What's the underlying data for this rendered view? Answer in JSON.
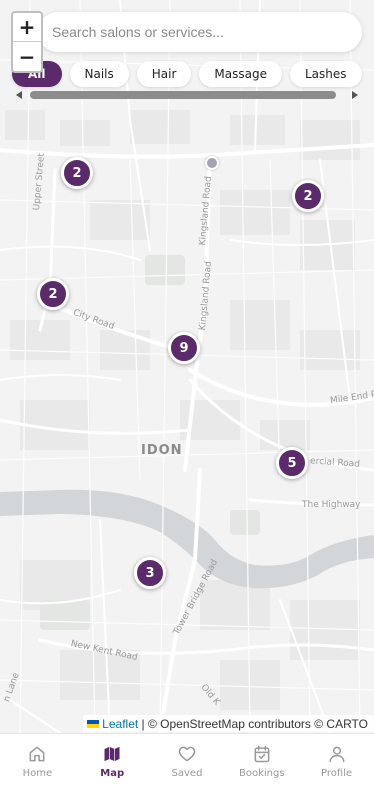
{
  "search": {
    "placeholder": "Search salons or services..."
  },
  "zoom": {
    "in_label": "+",
    "out_label": "−"
  },
  "categories": [
    {
      "label": "All",
      "active": true
    },
    {
      "label": "Nails",
      "active": false
    },
    {
      "label": "Hair",
      "active": false
    },
    {
      "label": "Massage",
      "active": false
    },
    {
      "label": "Lashes",
      "active": false
    }
  ],
  "map": {
    "labels": {
      "upper_street": "Upper Street",
      "kingsland_road_1": "Kingsland Road",
      "kingsland_road_2": "Kingsland Road",
      "city_road": "City Road",
      "mile_end": "Mile End R",
      "commercial_road": "ercial Road",
      "the_highway": "The Highway",
      "london": "IDON",
      "tower_bridge_road": "Tower Bridge Road",
      "new_kent_road": "New Kent Road",
      "old_kent": "Old K",
      "lane": "n Lane"
    },
    "clusters": [
      {
        "id": "c1",
        "count": "2"
      },
      {
        "id": "c2",
        "count": "2"
      },
      {
        "id": "c3",
        "count": "2"
      },
      {
        "id": "c4",
        "count": "9"
      },
      {
        "id": "c5",
        "count": "5"
      },
      {
        "id": "c6",
        "count": "3"
      }
    ],
    "attribution": {
      "leaflet": "Leaflet",
      "rest": "| © OpenStreetMap contributors © CARTO"
    }
  },
  "tabs": [
    {
      "label": "Home",
      "icon": "home-icon",
      "active": false
    },
    {
      "label": "Map",
      "icon": "map-icon",
      "active": true
    },
    {
      "label": "Saved",
      "icon": "heart-icon",
      "active": false
    },
    {
      "label": "Bookings",
      "icon": "calendar-check-icon",
      "active": false
    },
    {
      "label": "Profile",
      "icon": "user-icon",
      "active": false
    }
  ],
  "colors": {
    "accent": "#5a2a6b",
    "inactive": "#9a9a9a",
    "river": "#d3d6d8"
  }
}
